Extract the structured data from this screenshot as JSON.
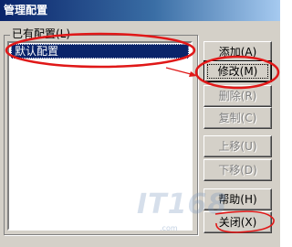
{
  "window": {
    "title": "管理配置"
  },
  "profiles": {
    "group_label": "已有配置(L)",
    "items": [
      "默认配置"
    ],
    "selected_index": 0
  },
  "buttons": {
    "add": "添加(A)",
    "modify": "修改(M)",
    "delete": "删除(R)",
    "copy": "复制(C)",
    "move_up": "上移(U)",
    "move_down": "下移(D)",
    "help": "帮助(H)",
    "close": "关闭(X)"
  },
  "watermark": {
    "text": "IT168",
    "sub": ".com"
  },
  "colors": {
    "annotation": "#e01818",
    "selection": "#0a246a",
    "titlebar": "#0a246a"
  }
}
